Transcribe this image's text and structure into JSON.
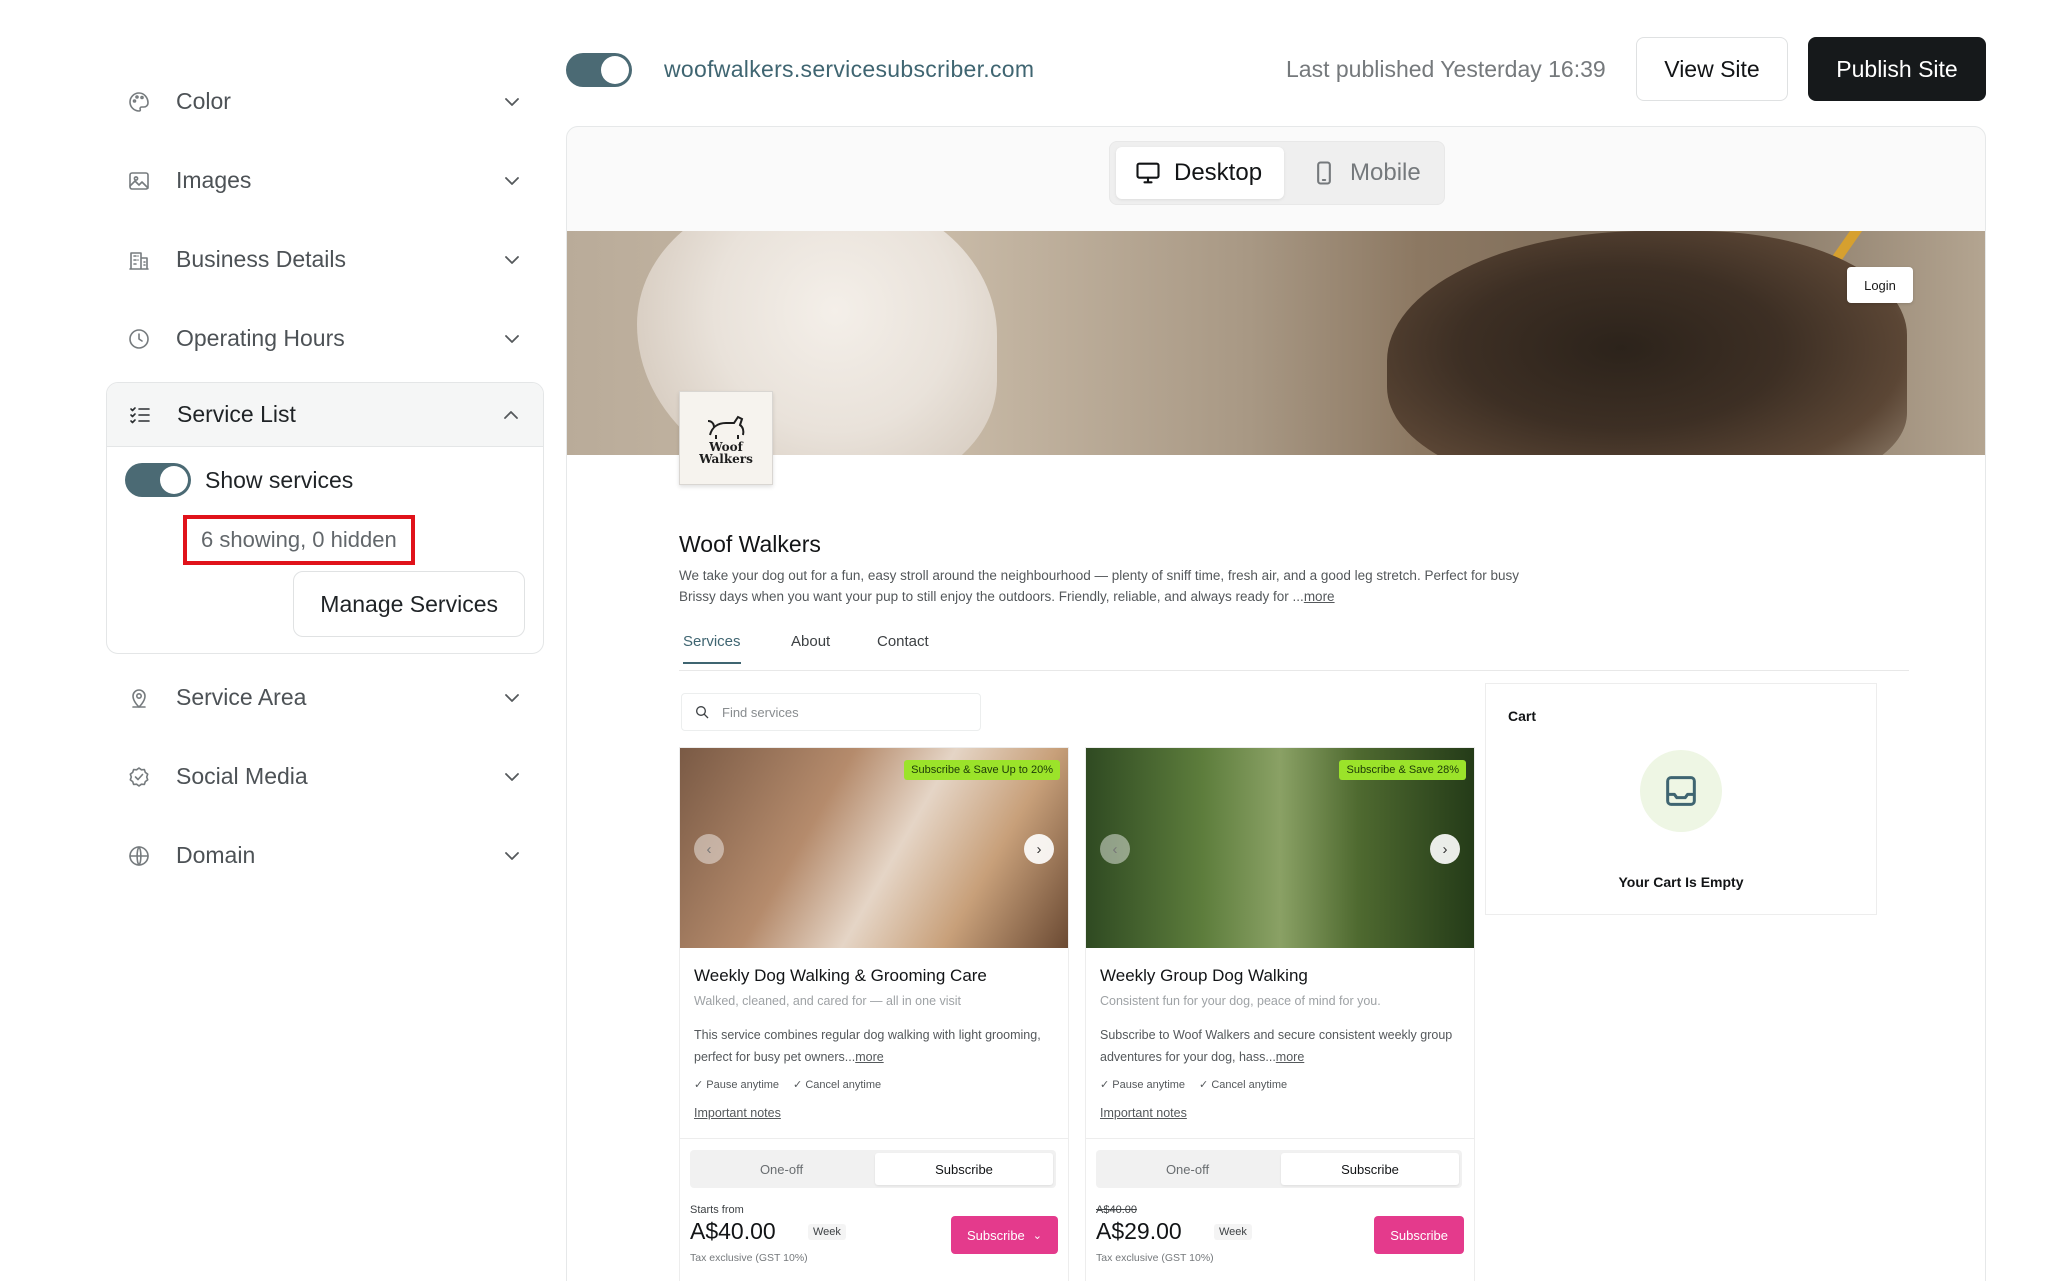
{
  "sidebar": {
    "items_top": [
      {
        "label": "Color",
        "icon": "palette-icon"
      },
      {
        "label": "Images",
        "icon": "image-icon"
      },
      {
        "label": "Business Details",
        "icon": "building-icon"
      },
      {
        "label": "Operating Hours",
        "icon": "clock-icon"
      }
    ],
    "service_list": {
      "label": "Service List",
      "icon": "list-checks-icon",
      "show_label": "Show services",
      "show_enabled": true,
      "counts": "6 showing, 0 hidden",
      "manage_label": "Manage Services"
    },
    "items_bottom": [
      {
        "label": "Service Area",
        "icon": "map-pin-icon"
      },
      {
        "label": "Social Media",
        "icon": "badge-check-icon"
      },
      {
        "label": "Domain",
        "icon": "globe-icon"
      }
    ]
  },
  "topbar": {
    "site_enabled": true,
    "url": "woofwalkers.servicesubscriber.com",
    "last_published": "Last published Yesterday 16:39",
    "view_label": "View Site",
    "publish_label": "Publish Site"
  },
  "device": {
    "desktop_label": "Desktop",
    "mobile_label": "Mobile",
    "selected": "Desktop"
  },
  "site": {
    "login_label": "Login",
    "logo_text_1": "Woof",
    "logo_text_2": "Walkers",
    "business_name": "Woof Walkers",
    "description": "We take your dog out for a fun, easy stroll around the neighbourhood — plenty of sniff time, fresh air, and a good leg stretch. Perfect for busy Brissy days when you want your pup to still enjoy the outdoors. Friendly, reliable, and always ready for ...",
    "description_more": "more",
    "tabs": [
      "Services",
      "About",
      "Contact"
    ],
    "search_placeholder": "Find services",
    "cards": [
      {
        "promo": "Subscribe & Save Up to 20%",
        "title": "Weekly Dog Walking & Grooming Care",
        "subtitle": "Walked, cleaned, and cared for — all in one visit",
        "desc": "This service combines regular dog walking with light grooming, perfect for busy pet owners...",
        "more": "more",
        "feat1": "Pause anytime",
        "feat2": "Cancel anytime",
        "notes": "Important notes",
        "oneoff": "One-off",
        "subscribe_tab": "Subscribe",
        "pre_price": "Starts from",
        "price": "A$40.00",
        "per": "Week",
        "tax": "Tax exclusive (GST 10%)",
        "btn": "Subscribe"
      },
      {
        "promo": "Subscribe & Save 28%",
        "title": "Weekly Group Dog Walking",
        "subtitle": "Consistent fun for your dog, peace of mind for you.",
        "desc": "Subscribe to Woof Walkers and secure consistent weekly group adventures for your dog, hass...",
        "more": "more",
        "feat1": "Pause anytime",
        "feat2": "Cancel anytime",
        "notes": "Important notes",
        "oneoff": "One-off",
        "subscribe_tab": "Subscribe",
        "old_price": "A$40.00",
        "price": "A$29.00",
        "per": "Week",
        "tax": "Tax exclusive (GST 10%)",
        "btn": "Subscribe"
      }
    ],
    "cart": {
      "title": "Cart",
      "empty": "Your Cart Is Empty"
    }
  },
  "colors": {
    "accent": "#4b6a74",
    "primary_button": "#16191b",
    "subscribe_button": "#e43a8c",
    "promo_badge": "#9be32a",
    "highlight_box": "#e0121a"
  }
}
